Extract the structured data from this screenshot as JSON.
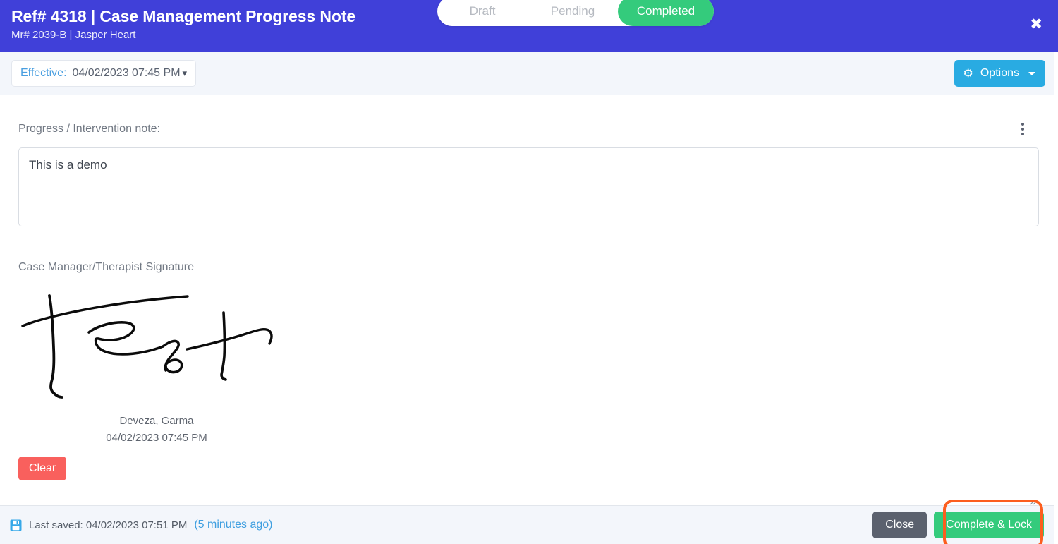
{
  "header": {
    "title": "Ref# 4318 | Case Management Progress Note",
    "subtitle": "Mr# 2039-B | Jasper Heart",
    "close_label": "✖",
    "bg_color": "#4040d9"
  },
  "toolbar": {
    "effective_label": "Effective:",
    "effective_value": "04/02/2023 07:45 PM",
    "caret": "▾",
    "status_steps": [
      {
        "label": "Draft",
        "active": false
      },
      {
        "label": "Pending",
        "active": false
      },
      {
        "label": "Completed",
        "active": true
      }
    ],
    "active_color": "#34cb7c",
    "options_label": "Options",
    "options_icon": "gear-icon",
    "options_glyph": "⚙",
    "options_color": "#29abe2"
  },
  "main": {
    "note_label": "Progress / Intervention note:",
    "note_value": "This is a demo",
    "note_placeholder": "",
    "kebab_icon": "more-vertical-icon",
    "signature_label": "Case Manager/Therapist Signature",
    "signature_text": "Test",
    "signer_name": "Deveza, Garma",
    "signed_at": "04/02/2023 07:45 PM",
    "clear_label": "Clear",
    "clear_color": "#f9605d"
  },
  "footer": {
    "save_icon": "save-icon",
    "last_saved_text": "Last saved: 04/02/2023 07:51 PM",
    "last_saved_relative": "(5 minutes ago)",
    "close_label": "Close",
    "complete_label": "Complete & Lock",
    "complete_color": "#34cb7c",
    "highlight_color": "#fc5e1f"
  }
}
